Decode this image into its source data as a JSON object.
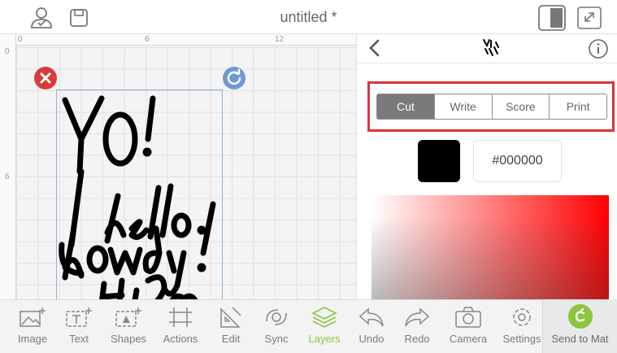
{
  "header": {
    "title": "untitled *"
  },
  "canvas": {
    "ruler_top": [
      "0",
      "6",
      "12"
    ],
    "ruler_left": [
      "0",
      "6"
    ]
  },
  "panel": {
    "tabs": [
      "Cut",
      "Write",
      "Score",
      "Print"
    ],
    "active_tab": "Cut",
    "color_hex": "#000000",
    "swatch_color": "#000000"
  },
  "toolbar": {
    "items": [
      {
        "label": "Image",
        "icon": "image-add-icon"
      },
      {
        "label": "Text",
        "icon": "text-add-icon"
      },
      {
        "label": "Shapes",
        "icon": "shapes-add-icon"
      },
      {
        "label": "Actions",
        "icon": "actions-icon"
      },
      {
        "label": "Edit",
        "icon": "edit-icon"
      },
      {
        "label": "Sync",
        "icon": "sync-icon"
      },
      {
        "label": "Layers",
        "icon": "layers-icon"
      },
      {
        "label": "Undo",
        "icon": "undo-icon"
      },
      {
        "label": "Redo",
        "icon": "redo-icon"
      },
      {
        "label": "Camera",
        "icon": "camera-icon"
      },
      {
        "label": "Settings",
        "icon": "settings-icon"
      }
    ],
    "active": "Layers",
    "send_label": "Send to Mat"
  },
  "colors": {
    "accent_green": "#8cc63f",
    "highlight_red": "#d9363e",
    "delete_red": "#d63c3c",
    "rotate_blue": "#6b9ad4"
  }
}
